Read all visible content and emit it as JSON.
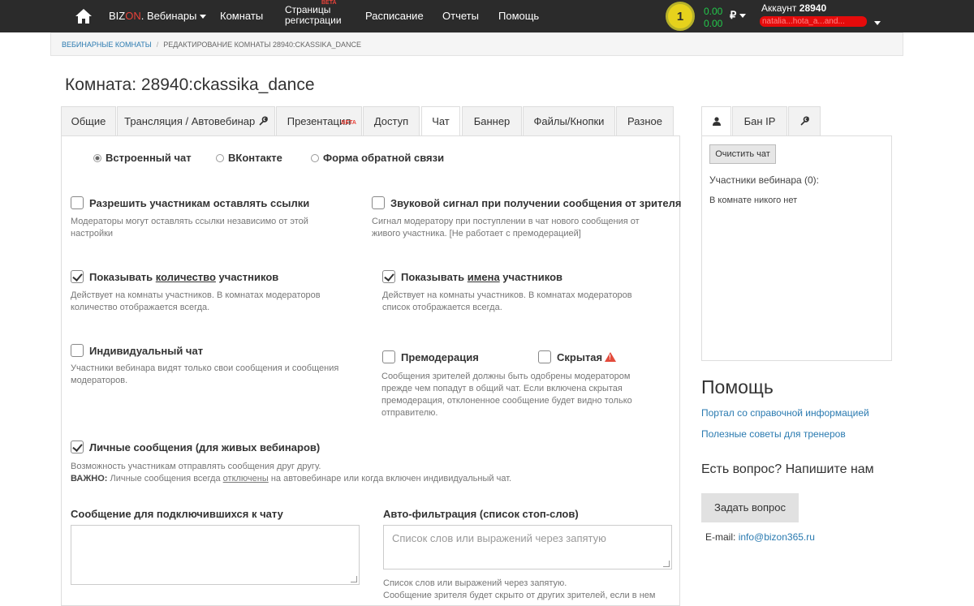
{
  "topnav": {
    "brand_prefix": "BIZ",
    "brand_on": "ON",
    "brand_suffix": ". Вебинары",
    "rooms": "Комнаты",
    "reg_pages_line1": "Страницы",
    "reg_pages_line2": "регистрации",
    "reg_beta": "BETA",
    "schedule": "Расписание",
    "reports": "Отчеты",
    "help": "Помощь",
    "coin_value": "1",
    "balance1": "0.00",
    "balance2": "0.00",
    "currency": "₽",
    "account_label": "Аккаунт",
    "account_number": "28940",
    "account_email_masked": "natalia...hota_a...and..."
  },
  "breadcrumb": {
    "root": "ВЕБИНАРНЫЕ КОМНАТЫ",
    "sep": "/",
    "current": "РЕДАКТИРОВАНИЕ КОМНАТЫ 28940:CKASSIKA_DANCE"
  },
  "page_title": "Комната: 28940:ckassika_dance",
  "tabs": [
    {
      "label": "Общие"
    },
    {
      "label": "Трансляция / Автовебинар"
    },
    {
      "label": "Презентация",
      "badge": "BETA"
    },
    {
      "label": "Доступ"
    },
    {
      "label": "Чат"
    },
    {
      "label": "Баннер"
    },
    {
      "label": "Файлы/Кнопки"
    },
    {
      "label": "Разное"
    }
  ],
  "chat_type": {
    "builtin": "Встроенный чат",
    "vk": "ВКонтакте",
    "feedback": "Форма обратной связи"
  },
  "options": {
    "allow_links": {
      "label": "Разрешить участникам оставлять ссылки",
      "desc1": "Модераторы могут оставлять ссылки независимо от этой",
      "desc2": "настройки",
      "checked": false
    },
    "sound": {
      "label": "Звуковой сигнал при получении сообщения от зрителя",
      "desc1": "Сигнал модератору при поступлении в чат нового сообщения от",
      "desc2": "живого участника. [Не работает с премодерацией]",
      "checked": false
    },
    "show_count": {
      "label_pre": "Показывать ",
      "label_u": "количество",
      "label_post": " участников",
      "desc1": "Действует на комнаты участников. В комнатах модераторов",
      "desc2": "количество отображается всегда.",
      "checked": true
    },
    "show_names": {
      "label_pre": "Показывать ",
      "label_u": "имена",
      "label_post": " участников",
      "desc1": "Действует на комнаты участников. В комнатах модераторов",
      "desc2": "список отображается всегда.",
      "checked": true
    },
    "individual": {
      "label": "Индивидуальный чат",
      "desc1": "Участники вебинара видят только свои сообщения и сообщения",
      "desc2": "модераторов.",
      "checked": false
    },
    "premod": {
      "label": "Премодерация",
      "checked": false
    },
    "hidden": {
      "label": "Скрытая",
      "checked": false
    },
    "premod_desc": [
      "Сообщения зрителей должны быть одобрены модератором",
      "прежде чем попадут в общий чат. Если включена скрытая",
      "премодерация, отклоненное сообщение будет видно только",
      "отправителю."
    ],
    "private": {
      "label": "Личные сообщения (для живых вебинаров)",
      "desc1": "Возможность участникам отправлять сообщения друг другу.",
      "desc2_bold": "ВАЖНО:",
      "desc2_pre": " Личные сообщения всегда ",
      "desc2_u": "отключены",
      "desc2_post": " на автовебинаре или когда включен индивидуальный чат.",
      "checked": true
    }
  },
  "welcome_msg": {
    "label": "Сообщение для подключившихся к чату",
    "value": ""
  },
  "autofilter": {
    "label": "Авто-фильтрация (список стоп-слов)",
    "placeholder": "Список слов или выражений через запятую",
    "desc1": "Список слов или выражений через запятую.",
    "desc2": "Сообщение зрителя будет скрыто от других зрителей, если в нем"
  },
  "sidebar": {
    "tab_ban": "Бан IP",
    "clear_chat": "Очистить чат",
    "participants": "Участники вебинара (0):",
    "empty": "В комнате никого нет"
  },
  "help": {
    "title": "Помощь",
    "portal": "Портал со справочной информацией",
    "tips": "Полезные советы для тренеров",
    "ask_title": "Есть вопрос? Напишите нам",
    "ask_button": "Задать вопрос",
    "email_label": "E-mail:",
    "email": "info@bizon365.ru"
  },
  "colors": {
    "topbar": "#2b2b2b",
    "link": "#2a7ab0",
    "accent_red": "#e8423a",
    "balance_green": "#23c84b"
  }
}
